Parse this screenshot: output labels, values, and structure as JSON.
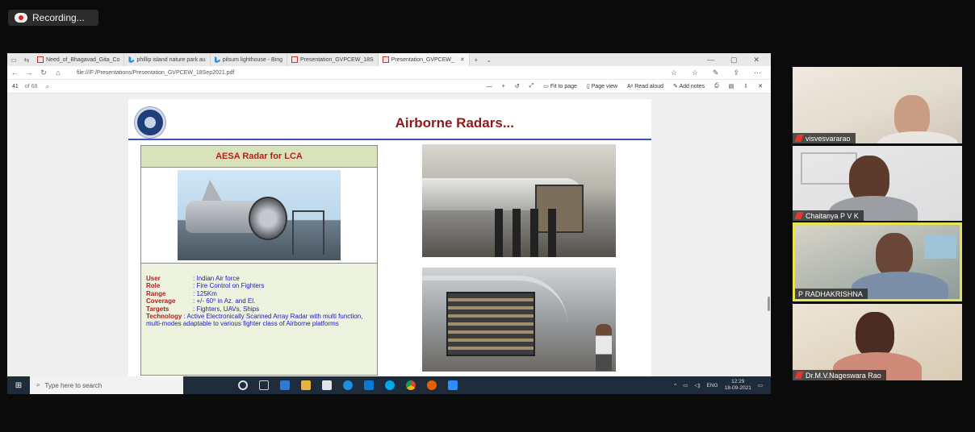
{
  "recording": {
    "label": "Recording..."
  },
  "browser": {
    "tabs": [
      {
        "label": "Need_of_Bhagavad_Gita_Co",
        "icon": "pdf"
      },
      {
        "label": "phillip island nature park au",
        "icon": "bing"
      },
      {
        "label": "pilsum lighthouse - Bing",
        "icon": "bing"
      },
      {
        "label": "Presentation_GVPCEW_18S",
        "icon": "pdf"
      },
      {
        "label": "Presentation_GVPCEW_",
        "icon": "pdf",
        "active": true
      }
    ],
    "new_tab": "+",
    "url": "file:///F:/Presentations/Presentation_GVPCEW_18Sep2021.pdf",
    "pdf_toolbar": {
      "page": "41",
      "page_total": "of 68",
      "zoom_out": "—",
      "zoom_in": "+",
      "fit_to_page": "Fit to page",
      "page_view": "Page view",
      "read_aloud": "Read aloud",
      "add_notes": "Add notes"
    }
  },
  "slide": {
    "title": "Airborne Radars...",
    "panel_title": "AESA Radar for LCA",
    "rows": [
      {
        "label": "User",
        "value": ": Indian Air force"
      },
      {
        "label": "Role",
        "value": ": Fire Control on Fighters"
      },
      {
        "label": "Range",
        "value": ": 125Km"
      },
      {
        "label": "Coverage",
        "value": ": +/- 60⁰ in Az. and El."
      },
      {
        "label": "Targets",
        "value": ": Fighters, UAVs, Ships"
      }
    ],
    "technology_label": "Technology",
    "technology_value": ": Active Electronically Scanned Array Radar with multi function, multi-modes adaptable to various fighter class of Airborne platforms"
  },
  "taskbar": {
    "search_placeholder": "Type here to search",
    "language": "ENG",
    "time": "12:29",
    "date": "18-09-2021"
  },
  "participants": [
    {
      "name": "visvesvararao"
    },
    {
      "name": "Chaitanya P V K"
    },
    {
      "name": "P RADHAKRISHNA",
      "active_speaker": true
    },
    {
      "name": "Dr.M.V.Nageswara Rao"
    }
  ],
  "colors": {
    "slide_title": "#8b1a1a",
    "panel_title": "#b3211e",
    "label": "#b01c1c",
    "value": "#1a1ab8",
    "active_speaker_border": "#e7e24f"
  }
}
